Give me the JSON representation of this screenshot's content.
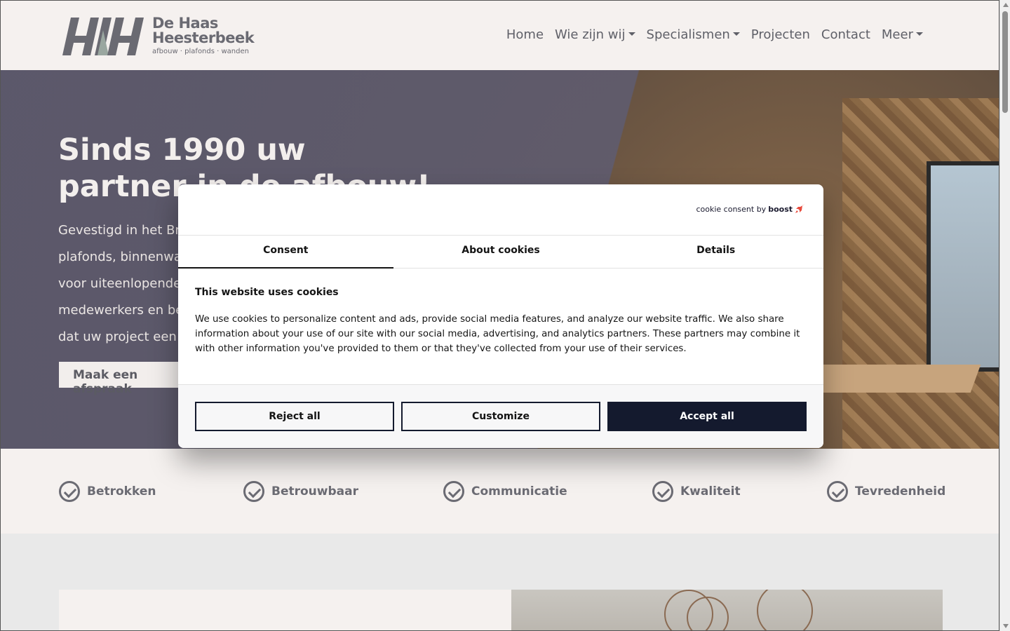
{
  "header": {
    "logo_name_line1": "De Haas",
    "logo_name_line2": "Heesterbeek",
    "logo_tagline": "afbouw · plafonds · wanden",
    "nav": [
      {
        "label": "Home"
      },
      {
        "label": "Wie zijn wij",
        "dropdown": true
      },
      {
        "label": "Specialismen",
        "dropdown": true
      },
      {
        "label": "Projecten"
      },
      {
        "label": "Contact"
      },
      {
        "label": "Meer",
        "dropdown": true
      }
    ]
  },
  "hero": {
    "title_line1": "Sinds 1990 uw",
    "title_line2": "partner in de afbouw!",
    "text_lines": [
      "Gevestigd in het Br",
      "plafonds, binnenwa",
      "voor uiteenlopende",
      "medewerkers en be",
      "dat uw project een"
    ],
    "cta_label": "Maak een afspraak"
  },
  "values": [
    {
      "label": "Betrokken"
    },
    {
      "label": "Betrouwbaar"
    },
    {
      "label": "Communicatie"
    },
    {
      "label": "Kwaliteit"
    },
    {
      "label": "Tevredenheid"
    }
  ],
  "cookie": {
    "brand_prefix": "cookie consent by",
    "brand_name": "boost",
    "tabs": [
      {
        "label": "Consent",
        "active": true
      },
      {
        "label": "About cookies",
        "active": false
      },
      {
        "label": "Details",
        "active": false
      }
    ],
    "heading": "This website uses cookies",
    "body": "We use cookies to personalize content and ads, provide social media features, and analyze our website traffic. We also share information about your use of our site with our social media, advertising, and analytics partners. These partners may combine it with other information you've provided to them or that they've collected from your use of their services.",
    "buttons": {
      "reject": "Reject all",
      "customize": "Customize",
      "accept": "Accept all"
    }
  },
  "colors": {
    "brand_gray": "#6a6a72",
    "accent_navy": "#141a2e",
    "page_bg": "#f5f1ef"
  }
}
